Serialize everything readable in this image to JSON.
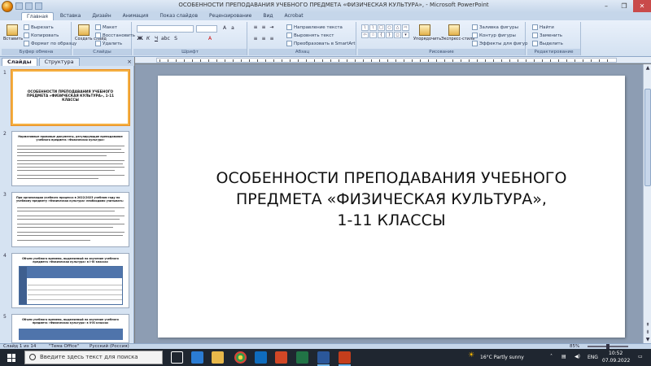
{
  "window": {
    "title": "ОСОБЕННОСТИ ПРЕПОДАВАНИЯ УЧЕБНОГО ПРЕДМЕТА «ФИЗИЧЕСКАЯ КУЛЬТУРА»,  - Microsoft PowerPoint",
    "minimize": "–",
    "maximize": "❐",
    "close": "✕"
  },
  "ribbon": {
    "tabs": [
      "Главная",
      "Вставка",
      "Дизайн",
      "Анимация",
      "Показ слайдов",
      "Рецензирование",
      "Вид",
      "Acrobat"
    ],
    "groups": {
      "clipboard": {
        "label": "Буфер обмена",
        "paste": "Вставить",
        "cut": "Вырезать",
        "copy": "Копировать",
        "format": "Формат по образцу"
      },
      "slides": {
        "label": "Слайды",
        "new_slide": "Создать слайд",
        "layout": "Макет",
        "reset": "Восстановить",
        "delete": "Удалить"
      },
      "font": {
        "label": "Шрифт"
      },
      "paragraph": {
        "label": "Абзац",
        "direction": "Направление текста",
        "align": "Выровнять текст",
        "smartart": "Преобразовать в SmartArt"
      },
      "drawing": {
        "label": "Рисование",
        "arrange": "Упорядочить",
        "quick_styles": "Экспресс-стили",
        "fill": "Заливка фигуры",
        "outline": "Контур фигуры",
        "effects": "Эффекты для фигур"
      },
      "editing": {
        "label": "Редактирование",
        "find": "Найти",
        "replace": "Заменить",
        "select": "Выделить"
      }
    }
  },
  "panel": {
    "tab_slides": "Слайды",
    "tab_outline": "Структура",
    "close": "×",
    "thumbnails": [
      {
        "num": "1",
        "title": "ОСОБЕННОСТИ ПРЕПОДАВАНИЯ УЧЕБНОГО ПРЕДМЕТА «ФИЗИЧЕСКАЯ КУЛЬТУРА», 1-11 КЛАССЫ"
      },
      {
        "num": "2",
        "title": "Нормативные правовые документы, регулирующие преподавание учебного предмета «Физическая культура»"
      },
      {
        "num": "3",
        "title": "При организации учебного процесса в 2022/2023 учебном году по учебному предмету «Физическая культура» необходимо учитывать:"
      },
      {
        "num": "4",
        "title": "Объем учебного времени, выделяемый на изучение учебного предмета «Физическая культура» в I-IV классах"
      },
      {
        "num": "5",
        "title": "Объем учебного времени, выделяемый на изучение учебного предмета «Физическая культура» в V-XI классах"
      }
    ]
  },
  "slide": {
    "title_line1": "ОСОБЕННОСТИ ПРЕПОДАВАНИЯ УЧЕБНОГО",
    "title_line2": "ПРЕДМЕТА «ФИЗИЧЕСКАЯ КУЛЬТУРА»,",
    "title_line3": "1-11 КЛАССЫ"
  },
  "statusbar": {
    "slide_counter": "Слайд 1 из 14",
    "theme": "\"Тема Office\"",
    "language": "Русский (Россия)",
    "zoom": "85%"
  },
  "taskbar": {
    "search_placeholder": "Введите здесь текст для поиска",
    "weather": "16°C  Partly sunny",
    "lang": "ENG",
    "time": "10:52",
    "date": "07.09.2022"
  },
  "colors": {
    "ribbon": "#dfe9f5",
    "panel": "#d6e3f2",
    "selection": "#f5b042",
    "taskbar": "#1f2630"
  }
}
